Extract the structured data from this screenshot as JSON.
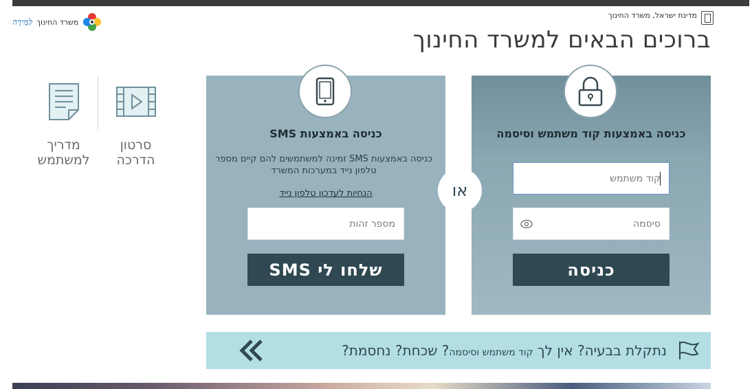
{
  "header": {
    "brand_name": "משרד החינוך",
    "brand_script": "לַמִּידָה",
    "gov_text": "מדינת ישראל, משרד החינוך",
    "welcome_title": "ברוכים הבאים למשרד החינוך"
  },
  "help": {
    "video_label": "סרטון הדרכה",
    "guide_label": "מדריך למשתמש"
  },
  "login_password": {
    "title": "כניסה באמצעות קוד משתמש וסיסמה",
    "user_placeholder": "קוד משתמש",
    "password_placeholder": "סיסמה",
    "submit_label": "כניסה"
  },
  "or_label": "או",
  "login_sms": {
    "title": "כניסה באמצעות SMS",
    "description": "כניסה באמצעות SMS זמינה למשתמשים להם קיים מספר טלפון נייד במערכות המשרד",
    "update_link": "הנחיות לעדכון טלפון נייד",
    "id_placeholder": "מספר זהות",
    "submit_label": "שלחו לי SMS"
  },
  "trouble": {
    "text_main": "נתקלת בבעיה? אין לך ",
    "text_small": "קוד משתמש וסיסמה",
    "text_end": "? שכחת? נחסמת?"
  },
  "colors": {
    "panel_dark": "#2f4852",
    "panel_right": "#8aa7b2",
    "panel_left": "#98b3be",
    "trouble_bg": "#b2dee4"
  }
}
